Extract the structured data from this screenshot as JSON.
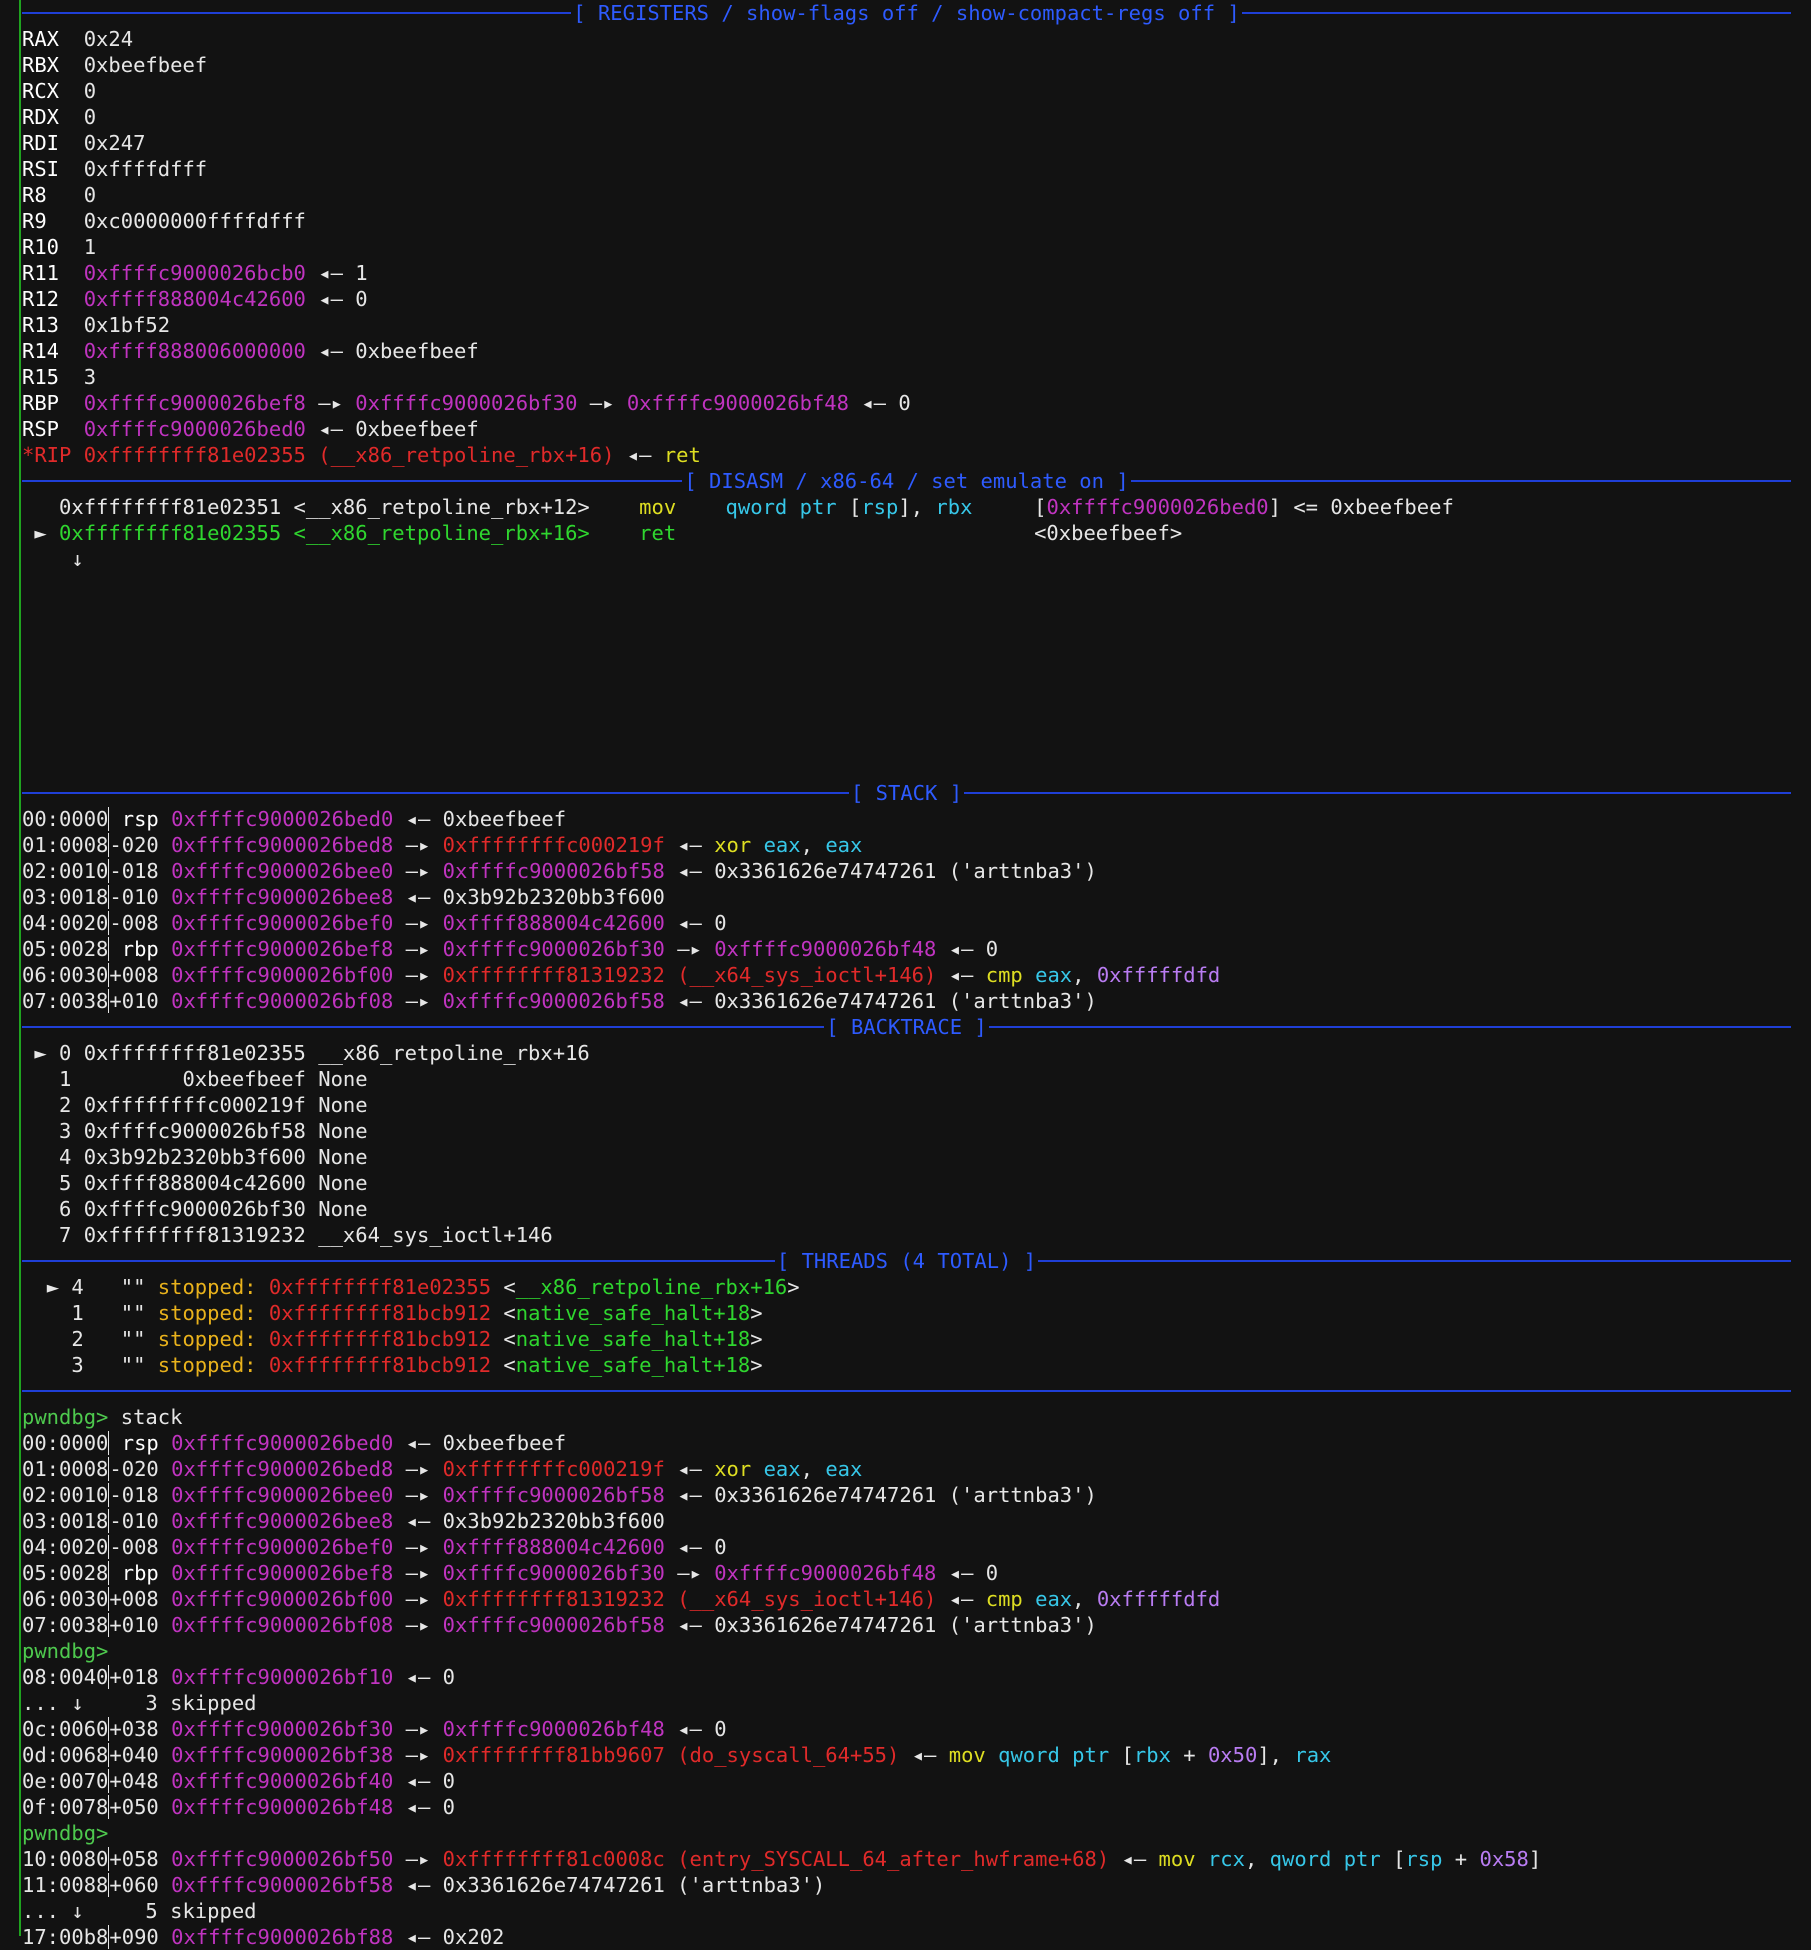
{
  "sections": {
    "registers": "[ REGISTERS / show-flags off / show-compact-regs off ]",
    "disasm": "[ DISASM / x86-64 / set emulate on ]",
    "stack": "[ STACK ]",
    "backtrace": "[ BACKTRACE ]",
    "threads": "[ THREADS (4 TOTAL) ]"
  },
  "registers": [
    {
      "name": "RAX",
      "val": "0x24"
    },
    {
      "name": "RBX",
      "val": "0xbeefbeef"
    },
    {
      "name": "RCX",
      "val": "0"
    },
    {
      "name": "RDX",
      "val": "0"
    },
    {
      "name": "RDI",
      "val": "0x247"
    },
    {
      "name": "RSI",
      "val": "0xffffdfff"
    },
    {
      "name": "R8",
      "val": "0"
    },
    {
      "name": "R9",
      "val": "0xc0000000ffffdfff"
    },
    {
      "name": "R10",
      "val": "1"
    },
    {
      "name": "R11",
      "addr": "0xffffc9000026bcb0",
      "arrow": "◂—",
      "tail": "1"
    },
    {
      "name": "R12",
      "addr": "0xffff888004c42600",
      "arrow": "◂—",
      "tail": "0"
    },
    {
      "name": "R13",
      "val": "0x1bf52"
    },
    {
      "name": "R14",
      "addr": "0xffff888006000000",
      "arrow": "◂—",
      "tail": "0xbeefbeef"
    },
    {
      "name": "R15",
      "val": "3"
    },
    {
      "name": "RBP",
      "addr": "0xffffc9000026bef8",
      "a1": "—▸",
      "addr2": "0xffffc9000026bf30",
      "a2": "—▸",
      "addr3": "0xffffc9000026bf48",
      "a3": "◂—",
      "tail": "0"
    },
    {
      "name": "RSP",
      "addr": "0xffffc9000026bed0",
      "arrow": "◂—",
      "tail": "0xbeefbeef"
    },
    {
      "name": "*RIP",
      "addr": "0xffffffff81e02355",
      "sym": "(__x86_retpoline_rbx+16)",
      "arrow": "◂—",
      "tail": "ret"
    }
  ],
  "disasm": {
    "line1": {
      "addr": "0xffffffff81e02351",
      "sym": "<__x86_retpoline_rbx+12>",
      "op": "mov",
      "arg1": "qword ptr",
      "br_open": "[",
      "reg1": "rsp",
      "br_close": "],",
      "reg2": "rbx",
      "c_open": "[",
      "c_addr": "0xffffc9000026bed0",
      "c_close": "]",
      "c_eq": "<=",
      "c_val": "0xbeefbeef"
    },
    "line2": {
      "marker": "►",
      "addr": "0xffffffff81e02355",
      "sym": "<__x86_retpoline_rbx+16>",
      "op": "ret",
      "target": "<0xbeefbeef>"
    },
    "down_arrow": "↓"
  },
  "stack": [
    {
      "idx": "00:0000",
      "off": "rsp",
      "addr": "0xffffc9000026bed0",
      "arrow": "◂—",
      "tail": "0xbeefbeef"
    },
    {
      "idx": "01:0008",
      "off": "-020",
      "addr": "0xffffc9000026bed8",
      "a1": "—▸",
      "addr2": "0xffffffffc000219f",
      "a2": "◂—",
      "op": "xor",
      "r1": "eax",
      "comma": ",",
      "r2": "eax"
    },
    {
      "idx": "02:0010",
      "off": "-018",
      "addr": "0xffffc9000026bee0",
      "a1": "—▸",
      "addr2": "0xffffc9000026bf58",
      "a2": "◂—",
      "tail": "0x3361626e74747261 ('arttnba3')"
    },
    {
      "idx": "03:0018",
      "off": "-010",
      "addr": "0xffffc9000026bee8",
      "arrow": "◂—",
      "tail": "0x3b92b2320bb3f600"
    },
    {
      "idx": "04:0020",
      "off": "-008",
      "addr": "0xffffc9000026bef0",
      "a1": "—▸",
      "addr2": "0xffff888004c42600",
      "a2": "◂—",
      "tail": "0"
    },
    {
      "idx": "05:0028",
      "off": "rbp",
      "addr": "0xffffc9000026bef8",
      "a1": "—▸",
      "addr2": "0xffffc9000026bf30",
      "a2": "—▸",
      "addr3": "0xffffc9000026bf48",
      "a3": "◂—",
      "tail": "0"
    },
    {
      "idx": "06:0030",
      "off": "+008",
      "addr": "0xffffc9000026bf00",
      "a1": "—▸",
      "addr2": "0xffffffff81319232",
      "sym": "(__x64_sys_ioctl+146)",
      "a2": "◂—",
      "op": "cmp",
      "r1": "eax",
      "comma": ",",
      "imm": "0xfffffdfd"
    },
    {
      "idx": "07:0038",
      "off": "+010",
      "addr": "0xffffc9000026bf08",
      "a1": "—▸",
      "addr2": "0xffffc9000026bf58",
      "a2": "◂—",
      "tail": "0x3361626e74747261 ('arttnba3')"
    }
  ],
  "backtrace": [
    {
      "marker": "►",
      "n": "0",
      "addr": "0xffffffff81e02355",
      "sym": "__x86_retpoline_rbx+16"
    },
    {
      "marker": "",
      "n": "1",
      "addr": "        0xbeefbeef",
      "sym": "None"
    },
    {
      "marker": "",
      "n": "2",
      "addr": "0xffffffffc000219f",
      "sym": "None"
    },
    {
      "marker": "",
      "n": "3",
      "addr": "0xffffc9000026bf58",
      "sym": "None"
    },
    {
      "marker": "",
      "n": "4",
      "addr": "0x3b92b2320bb3f600",
      "sym": "None"
    },
    {
      "marker": "",
      "n": "5",
      "addr": "0xffff888004c42600",
      "sym": "None"
    },
    {
      "marker": "",
      "n": "6",
      "addr": "0xffffc9000026bf30",
      "sym": "None"
    },
    {
      "marker": "",
      "n": "7",
      "addr": "0xffffffff81319232",
      "sym": "__x64_sys_ioctl+146"
    }
  ],
  "threads": [
    {
      "marker": "►",
      "id": "4",
      "name": "\"\"",
      "state": "stopped:",
      "addr": "0xffffffff81e02355",
      "lt": "<",
      "sym": "__x86_retpoline_rbx+16",
      "gt": ">"
    },
    {
      "marker": "",
      "id": "1",
      "name": "\"\"",
      "state": "stopped:",
      "addr": "0xffffffff81bcb912",
      "lt": "<",
      "sym": "native_safe_halt+18",
      "gt": ">"
    },
    {
      "marker": "",
      "id": "2",
      "name": "\"\"",
      "state": "stopped:",
      "addr": "0xffffffff81bcb912",
      "lt": "<",
      "sym": "native_safe_halt+18",
      "gt": ">"
    },
    {
      "marker": "",
      "id": "3",
      "name": "\"\"",
      "state": "stopped:",
      "addr": "0xffffffff81bcb912",
      "lt": "<",
      "sym": "native_safe_halt+18",
      "gt": ">"
    }
  ],
  "console": {
    "prompt": "pwndbg>",
    "command": "stack",
    "extra_rows": [
      {
        "idx": "08:0040",
        "off": "+018",
        "addr": "0xffffc9000026bf10",
        "arrow": "◂—",
        "tail": "0"
      },
      {
        "skip": "... ↓     3 skipped"
      },
      {
        "idx": "0c:0060",
        "off": "+038",
        "addr": "0xffffc9000026bf30",
        "a1": "—▸",
        "addr2": "0xffffc9000026bf48",
        "a2": "◂—",
        "tail": "0"
      },
      {
        "idx": "0d:0068",
        "off": "+040",
        "addr": "0xffffc9000026bf38",
        "a1": "—▸",
        "addr2": "0xffffffff81bb9607",
        "sym": "(do_syscall_64+55)",
        "a2": "◂—",
        "op": "mov",
        "arg": "qword ptr",
        "bo": "[",
        "reg": "rbx",
        "plus": "+",
        "imm": "0x50",
        "bc": "],",
        "reg2": "rax"
      },
      {
        "idx": "0e:0070",
        "off": "+048",
        "addr": "0xffffc9000026bf40",
        "arrow": "◂—",
        "tail": "0"
      },
      {
        "idx": "0f:0078",
        "off": "+050",
        "addr": "0xffffc9000026bf48",
        "arrow": "◂—",
        "tail": "0"
      }
    ],
    "extra_rows2": [
      {
        "idx": "10:0080",
        "off": "+058",
        "addr": "0xffffc9000026bf50",
        "a1": "—▸",
        "addr2": "0xffffffff81c0008c",
        "sym": "(entry_SYSCALL_64_after_hwframe+68)",
        "a2": "◂—",
        "op": "mov",
        "reg1": "rcx",
        "comma": ",",
        "arg": "qword ptr",
        "bo": "[",
        "reg": "rsp",
        "plus": "+",
        "imm": "0x58",
        "bc": "]"
      },
      {
        "idx": "11:0088",
        "off": "+060",
        "addr": "0xffffc9000026bf58",
        "arrow": "◂—",
        "tail": "0x3361626e74747261 ('arttnba3')"
      },
      {
        "skip": "... ↓     5 skipped"
      },
      {
        "idx": "17:00b8",
        "off": "+090",
        "addr": "0xffffc9000026bf88",
        "arrow": "◂—",
        "tail": "0x202"
      }
    ]
  }
}
